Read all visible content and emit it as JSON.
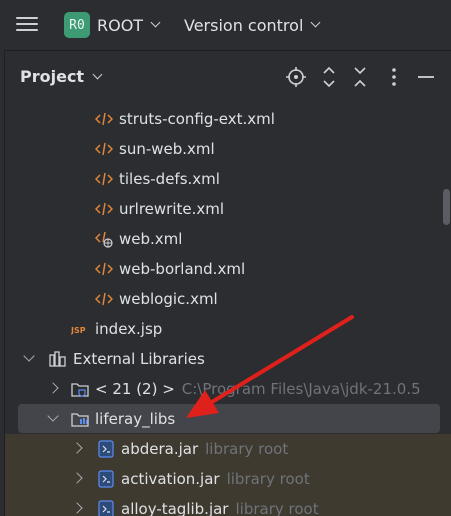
{
  "toolbar": {
    "project_badge": "R0",
    "project_name": "ROOT",
    "vcs_label": "Version control"
  },
  "tool_window": {
    "title": "Project"
  },
  "tree": {
    "xml_files": [
      "struts-config-ext.xml",
      "sun-web.xml",
      "tiles-defs.xml",
      "urlrewrite.xml",
      "web.xml",
      "web-borland.xml",
      "weblogic.xml"
    ],
    "jsp_file": "index.jsp",
    "external_libraries": "External Libraries",
    "jdk": {
      "label": "< 21 (2) >",
      "path": "C:\\Program Files\\Java\\jdk-21.0.5"
    },
    "liferay_libs": "liferay_libs",
    "jars": [
      {
        "label": "abdera.jar",
        "hint": "library root"
      },
      {
        "label": "activation.jar",
        "hint": "library root"
      },
      {
        "label": "alloy-taglib.jar",
        "hint": "library root"
      }
    ]
  },
  "colors": {
    "background": "#2b2d30",
    "project_badge": "#3d9b74",
    "selection": "#43454a",
    "library_row": "#3f3a2f",
    "annotation_arrow": "#e0201b"
  }
}
